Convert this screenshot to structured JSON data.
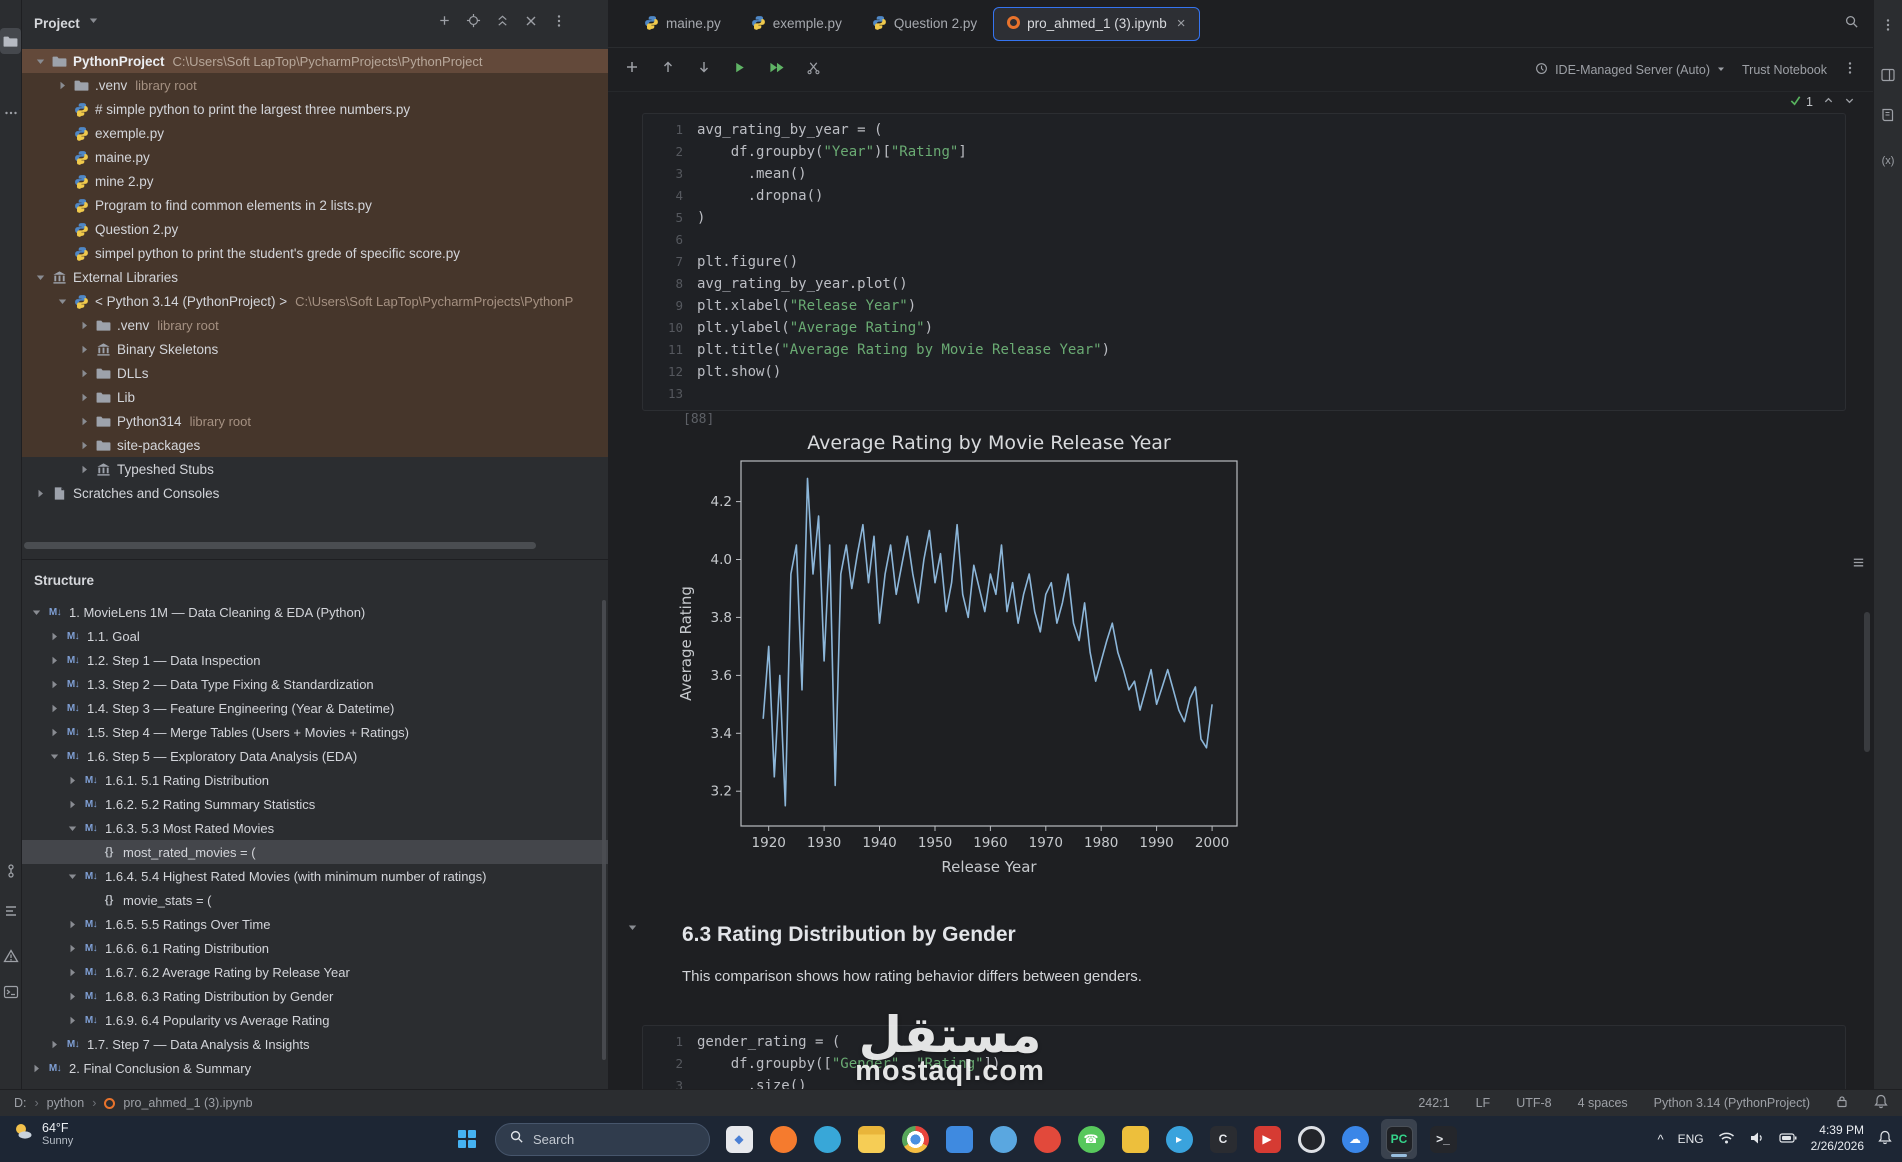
{
  "chart_data": {
    "type": "line",
    "title": "Average Rating by Movie Release Year",
    "xlabel": "Release Year",
    "ylabel": "Average Rating",
    "xlim": [
      1915,
      2004.5
    ],
    "ylim": [
      3.08,
      4.34
    ],
    "x_ticks": [
      1920,
      1930,
      1940,
      1950,
      1960,
      1970,
      1980,
      1990,
      2000
    ],
    "y_ticks": [
      3.2,
      3.4,
      3.6,
      3.8,
      4.0,
      4.2
    ],
    "grid": false,
    "legend": false,
    "line_color": "#8cb6d9",
    "series": [
      {
        "name": "avg_rating_by_year",
        "x_start": 1919,
        "x_step": 1,
        "values": [
          3.45,
          3.7,
          3.25,
          3.6,
          3.15,
          3.95,
          4.05,
          3.55,
          4.28,
          3.95,
          4.15,
          3.65,
          4.05,
          3.22,
          3.95,
          4.05,
          3.9,
          4.02,
          4.12,
          3.92,
          4.08,
          3.78,
          3.95,
          4.05,
          3.88,
          3.98,
          4.08,
          3.95,
          3.85,
          4.0,
          4.1,
          3.92,
          4.02,
          3.82,
          3.92,
          4.12,
          3.88,
          3.8,
          3.98,
          3.9,
          3.82,
          3.95,
          3.88,
          4.05,
          3.82,
          3.92,
          3.78,
          3.88,
          3.95,
          3.82,
          3.75,
          3.88,
          3.92,
          3.78,
          3.85,
          3.95,
          3.78,
          3.72,
          3.85,
          3.68,
          3.58,
          3.65,
          3.72,
          3.78,
          3.68,
          3.62,
          3.55,
          3.58,
          3.48,
          3.55,
          3.62,
          3.5,
          3.56,
          3.62,
          3.55,
          3.48,
          3.44,
          3.52,
          3.56,
          3.38,
          3.35,
          3.5
        ]
      }
    ]
  },
  "left_stripe": {
    "icons": [
      {
        "name": "project",
        "active": true
      },
      {
        "name": "more-tools"
      },
      {
        "name": "commit"
      },
      {
        "name": "structure-tool"
      },
      {
        "name": "problems"
      },
      {
        "name": "terminal"
      }
    ]
  },
  "right_stripe": {
    "icons": [
      {
        "name": "more"
      },
      {
        "name": "sci-view"
      },
      {
        "name": "documentation"
      },
      {
        "name": "variables"
      }
    ]
  },
  "project": {
    "title": "Project",
    "header_icons": [
      "add",
      "locate",
      "collapse-all",
      "hide",
      "more"
    ],
    "items": [
      {
        "label": "PythonProject",
        "suffix": "C:\\Users\\Soft LapTop\\PycharmProjects\\PythonProject",
        "icon": "folder",
        "level": 0,
        "chevron": "down",
        "state": "sel-brown",
        "bold": true
      },
      {
        "label": ".venv",
        "suffix": "library root",
        "icon": "folder",
        "level": 1,
        "chevron": "right",
        "state": "tint"
      },
      {
        "label": "# simple python to print the largest three numbers.py",
        "icon": "python",
        "level": 1,
        "state": "tint"
      },
      {
        "label": "exemple.py",
        "icon": "python",
        "level": 1,
        "state": "tint"
      },
      {
        "label": "maine.py",
        "icon": "python",
        "level": 1,
        "state": "tint"
      },
      {
        "label": "mine 2.py",
        "icon": "python",
        "level": 1,
        "state": "tint"
      },
      {
        "label": "Program to find common elements in 2 lists.py",
        "icon": "python",
        "level": 1,
        "state": "tint"
      },
      {
        "label": "Question 2.py",
        "icon": "python",
        "level": 1,
        "state": "tint"
      },
      {
        "label": "simpel python to print the student's grede of specific score.py",
        "icon": "python",
        "level": 1,
        "state": "tint"
      },
      {
        "label": "External Libraries",
        "icon": "library",
        "level": 0,
        "chevron": "down",
        "state": "tint"
      },
      {
        "label": "< Python 3.14 (PythonProject) >",
        "suffix": "C:\\Users\\Soft LapTop\\PycharmProjects\\PythonP",
        "icon": "python",
        "level": 1,
        "chevron": "down",
        "state": "tint"
      },
      {
        "label": ".venv",
        "suffix": "library root",
        "icon": "folder",
        "level": 2,
        "chevron": "right",
        "state": "tint"
      },
      {
        "label": "Binary Skeletons",
        "icon": "library",
        "level": 2,
        "chevron": "right",
        "state": "tint"
      },
      {
        "label": "DLLs",
        "icon": "folder",
        "level": 2,
        "chevron": "right",
        "state": "tint"
      },
      {
        "label": "Lib",
        "icon": "folder",
        "level": 2,
        "chevron": "right",
        "state": "tint"
      },
      {
        "label": "Python314",
        "suffix": "library root",
        "icon": "folder",
        "level": 2,
        "chevron": "right",
        "state": "tint"
      },
      {
        "label": "site-packages",
        "icon": "folder",
        "level": 2,
        "chevron": "right",
        "state": "tint"
      },
      {
        "label": "Typeshed Stubs",
        "icon": "library",
        "level": 2,
        "chevron": "right"
      },
      {
        "label": "Scratches and Consoles",
        "icon": "scratch",
        "level": 0,
        "chevron": "right"
      }
    ]
  },
  "structure": {
    "title": "Structure",
    "items": [
      {
        "label": "1. MovieLens 1M — Data Cleaning & EDA (Python)",
        "icon": "md",
        "level": 0,
        "chevron": "down"
      },
      {
        "label": "1.1. Goal",
        "icon": "md",
        "level": 1,
        "chevron": "right"
      },
      {
        "label": "1.2. Step 1 — Data Inspection",
        "icon": "md",
        "level": 1,
        "chevron": "right"
      },
      {
        "label": "1.3. Step 2 — Data Type Fixing & Standardization",
        "icon": "md",
        "level": 1,
        "chevron": "right"
      },
      {
        "label": "1.4. Step 3 — Feature Engineering (Year & Datetime)",
        "icon": "md",
        "level": 1,
        "chevron": "right"
      },
      {
        "label": "1.5. Step 4 — Merge Tables (Users + Movies + Ratings)",
        "icon": "md",
        "level": 1,
        "chevron": "right"
      },
      {
        "label": "1.6. Step 5 — Exploratory Data Analysis (EDA)",
        "icon": "md",
        "level": 1,
        "chevron": "down"
      },
      {
        "label": "1.6.1. 5.1 Rating Distribution",
        "icon": "md",
        "level": 2,
        "chevron": "right"
      },
      {
        "label": "1.6.2. 5.2 Rating Summary Statistics",
        "icon": "md",
        "level": 2,
        "chevron": "right"
      },
      {
        "label": "1.6.3. 5.3 Most Rated Movies",
        "icon": "md",
        "level": 2,
        "chevron": "down"
      },
      {
        "label": "most_rated_movies = (",
        "icon": "braces",
        "level": 3,
        "state": "sel-gray"
      },
      {
        "label": "1.6.4. 5.4 Highest Rated Movies (with minimum number of ratings)",
        "icon": "md",
        "level": 2,
        "chevron": "down"
      },
      {
        "label": "movie_stats = (",
        "icon": "braces",
        "level": 3
      },
      {
        "label": "1.6.5. 5.5 Ratings Over Time",
        "icon": "md",
        "level": 2,
        "chevron": "right"
      },
      {
        "label": "1.6.6. 6.1 Rating Distribution",
        "icon": "md",
        "level": 2,
        "chevron": "right"
      },
      {
        "label": "1.6.7. 6.2 Average Rating by Release Year",
        "icon": "md",
        "level": 2,
        "chevron": "right"
      },
      {
        "label": "1.6.8. 6.3 Rating Distribution by Gender",
        "icon": "md",
        "level": 2,
        "chevron": "right"
      },
      {
        "label": "1.6.9. 6.4 Popularity vs Average Rating",
        "icon": "md",
        "level": 2,
        "chevron": "right"
      },
      {
        "label": "1.7. Step 7 — Data Analysis & Insights",
        "icon": "md",
        "level": 1,
        "chevron": "right"
      },
      {
        "label": "2. Final Conclusion & Summary",
        "icon": "md",
        "level": 0,
        "chevron": "right"
      }
    ]
  },
  "editor": {
    "tabs": [
      {
        "label": "maine.py",
        "icon": "python"
      },
      {
        "label": "exemple.py",
        "icon": "python"
      },
      {
        "label": "Question 2.py",
        "icon": "python"
      },
      {
        "label": "pro_ahmed_1 (3).ipynb",
        "icon": "notebook",
        "active": true,
        "close": "×"
      }
    ],
    "toolbar": {
      "left_icons": [
        "add-cell",
        "move-up",
        "move-down",
        "run-cell",
        "run-all",
        "cut-cell"
      ],
      "server_label": "IDE-Managed Server (Auto)",
      "trust_label": "Trust Notebook"
    },
    "exec_check": "1",
    "cells": [
      {
        "exec_label": "[88]",
        "lines": [
          [
            [
              "avg_rating_by_year = (",
              "d"
            ]
          ],
          [
            [
              "    df.groupby(",
              "d"
            ],
            [
              "\"Year\"",
              "s"
            ],
            [
              ")[",
              "d"
            ],
            [
              "\"Rating\"",
              "s"
            ],
            [
              "]",
              "d"
            ]
          ],
          [
            [
              "      .mean()",
              "d"
            ]
          ],
          [
            [
              "      .dropna()",
              "d"
            ]
          ],
          [
            [
              ")",
              "d"
            ]
          ],
          [
            [
              "",
              "d"
            ]
          ],
          [
            [
              "plt.figure()",
              "d"
            ]
          ],
          [
            [
              "avg_rating_by_year.plot()",
              "d"
            ]
          ],
          [
            [
              "plt.xlabel(",
              "d"
            ],
            [
              "\"Release Year\"",
              "s"
            ],
            [
              ")",
              "d"
            ]
          ],
          [
            [
              "plt.ylabel(",
              "d"
            ],
            [
              "\"Average Rating\"",
              "s"
            ],
            [
              ")",
              "d"
            ]
          ],
          [
            [
              "plt.title(",
              "d"
            ],
            [
              "\"Average Rating by Movie Release Year\"",
              "s"
            ],
            [
              ")",
              "d"
            ]
          ],
          [
            [
              "plt.show()",
              "d"
            ]
          ],
          [
            [
              "",
              "d"
            ]
          ]
        ]
      },
      {
        "lines": [
          [
            [
              "gender_rating = (",
              "d"
            ]
          ],
          [
            [
              "    df.groupby([",
              "d"
            ],
            [
              "\"Gender\"",
              "s"
            ],
            [
              ", ",
              "d"
            ],
            [
              "\"Rating\"",
              "s"
            ],
            [
              "])",
              "d"
            ]
          ],
          [
            [
              "      .size()",
              "d"
            ]
          ]
        ]
      }
    ],
    "markdown": {
      "heading": "6.3 Rating Distribution by Gender",
      "paragraph": "This comparison shows how rating behavior differs between genders."
    }
  },
  "status_bar": {
    "breadcrumbs": [
      "D:",
      "python",
      "pro_ahmed_1 (3).ipynb"
    ],
    "items": [
      "242:1",
      "LF",
      "UTF-8",
      "4 spaces",
      "Python 3.14 (PythonProject)"
    ]
  },
  "taskbar": {
    "weather": {
      "temp": "64°F",
      "condition": "Sunny"
    },
    "search_placeholder": "Search",
    "apps": [
      {
        "name": "photos",
        "shape": "square",
        "color": "#e7e9ed",
        "glyph": "◆",
        "fg": "#4a7fd4"
      },
      {
        "name": "firefox",
        "shape": "circle",
        "color": "#f57b2e"
      },
      {
        "name": "edge",
        "shape": "circle",
        "color": "#38a7d8"
      },
      {
        "name": "file-explorer",
        "shape": "folder",
        "color": "#f3c84b"
      },
      {
        "name": "chrome",
        "shape": "chrome",
        "color": ""
      },
      {
        "name": "microsoft-store",
        "shape": "square",
        "color": "#3f8ae0"
      },
      {
        "name": "paint",
        "shape": "circle",
        "color": "#5aa7e0"
      },
      {
        "name": "opera",
        "shape": "circle",
        "color": "#e2493b"
      },
      {
        "name": "whatsapp",
        "shape": "circle",
        "color": "#57c85c",
        "glyph": "☎",
        "fg": "#ffffff"
      },
      {
        "name": "sticky-notes",
        "shape": "square",
        "color": "#edbf3c"
      },
      {
        "name": "telegram",
        "shape": "circle",
        "color": "#3aa3dd",
        "glyph": "▸",
        "fg": "#ffffff"
      },
      {
        "name": "cursor",
        "shape": "square",
        "color": "#2a2c31",
        "glyph": "C",
        "fg": "#e8eaee"
      },
      {
        "name": "youtube",
        "shape": "square",
        "color": "#d63b33",
        "glyph": "▶",
        "fg": "#ffffff"
      },
      {
        "name": "obs-studio",
        "shape": "ring",
        "color": "#23252a"
      },
      {
        "name": "onedrive",
        "shape": "circle",
        "color": "#3a86e8",
        "glyph": "☁",
        "fg": "#ffffff"
      },
      {
        "name": "pycharm",
        "shape": "square",
        "color": "#1f2125",
        "glyph": "PC",
        "fg": "#35d48a",
        "border": "#4a5058",
        "active": true
      },
      {
        "name": "terminal",
        "shape": "square",
        "color": "#24262b",
        "glyph": ">_",
        "fg": "#e6e9ed"
      }
    ],
    "tray": {
      "chevron": "^",
      "language": "ENG",
      "time": "4:39 PM",
      "date": "2/26/2026"
    }
  },
  "watermark": {
    "arabic": "مستقل",
    "latin": "mostaql.com"
  }
}
